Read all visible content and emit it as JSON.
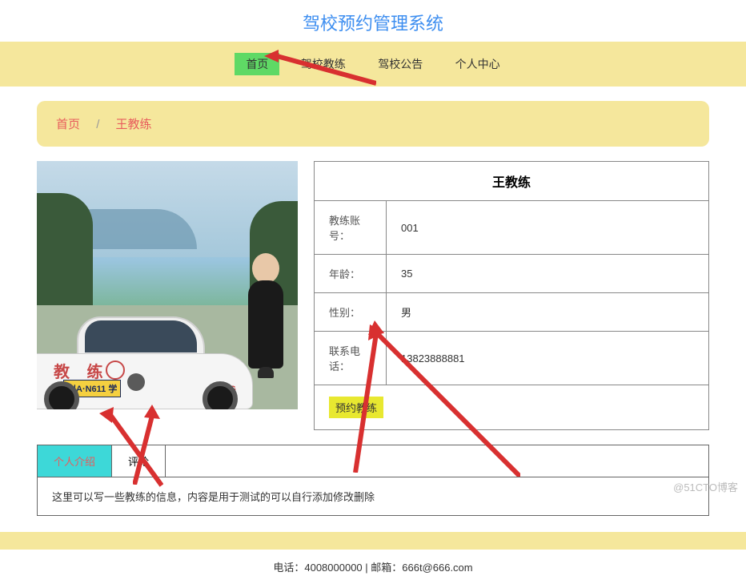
{
  "header": {
    "title": "驾校预约管理系统"
  },
  "nav": {
    "items": [
      {
        "label": "首页",
        "active": true
      },
      {
        "label": "驾校教练",
        "active": false
      },
      {
        "label": "驾校公告",
        "active": false
      },
      {
        "label": "个人中心",
        "active": false
      }
    ]
  },
  "breadcrumb": {
    "home": "首页",
    "separator": "/",
    "current": "王教练"
  },
  "coach": {
    "name": "王教练",
    "fields": [
      {
        "label": "教练账号：",
        "value": "001"
      },
      {
        "label": "年龄：",
        "value": "35"
      },
      {
        "label": "性别：",
        "value": "男"
      },
      {
        "label": "联系电话：",
        "value": "13823888881"
      }
    ],
    "booking_label": "预约教练"
  },
  "car": {
    "brand_text": "教  练",
    "plate": "川A·N611 学",
    "cng": "CNG"
  },
  "tabs": {
    "items": [
      {
        "label": "个人介绍",
        "active": true
      },
      {
        "label": "评论",
        "active": false
      }
    ],
    "content": "这里可以写一些教练的信息，内容是用于测试的可以自行添加修改删除"
  },
  "footer": {
    "text": "电话：4008000000 | 邮箱：666t@666.com"
  },
  "watermark": "@51CTO博客"
}
